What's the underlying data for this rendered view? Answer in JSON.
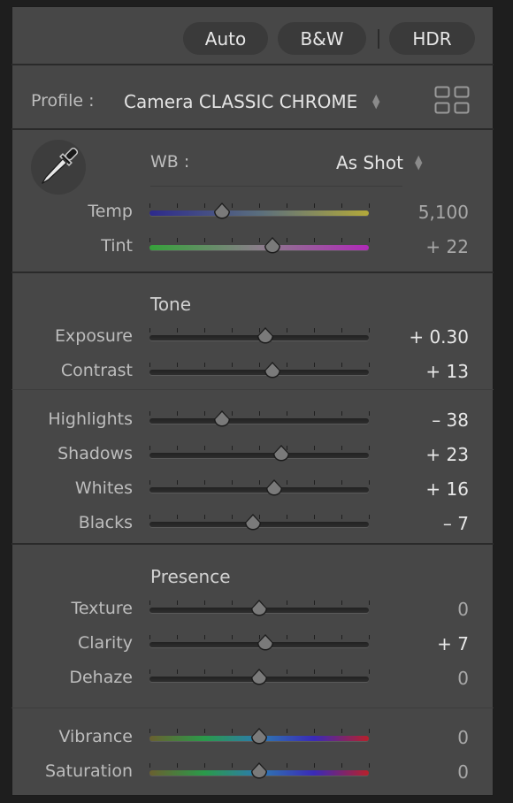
{
  "header": {
    "auto_label": "Auto",
    "bw_label": "B&W",
    "hdr_label": "HDR"
  },
  "profile": {
    "label": "Profile :",
    "value": "Camera CLASSIC CHROME",
    "browse_icon": "grid-icon"
  },
  "white_balance": {
    "picker_icon": "eyedropper-icon",
    "label": "WB :",
    "value": "As Shot"
  },
  "sections": {
    "tone": "Tone",
    "presence": "Presence"
  },
  "sliders": [
    {
      "key": "temp",
      "label": "Temp",
      "value": "5,100",
      "position": 0.33,
      "track": "temp",
      "dim": true
    },
    {
      "key": "tint",
      "label": "Tint",
      "value": "+ 22",
      "position": 0.56,
      "track": "tint",
      "dim": true
    },
    {
      "key": "exposure",
      "label": "Exposure",
      "value": "+ 0.30",
      "position": 0.53,
      "track": "neutral",
      "dim": false
    },
    {
      "key": "contrast",
      "label": "Contrast",
      "value": "+ 13",
      "position": 0.56,
      "track": "neutral",
      "dim": false
    },
    {
      "key": "highlights",
      "label": "Highlights",
      "value": "– 38",
      "position": 0.33,
      "track": "neutral",
      "dim": false
    },
    {
      "key": "shadows",
      "label": "Shadows",
      "value": "+ 23",
      "position": 0.6,
      "track": "neutral",
      "dim": false
    },
    {
      "key": "whites",
      "label": "Whites",
      "value": "+ 16",
      "position": 0.57,
      "track": "neutral",
      "dim": false
    },
    {
      "key": "blacks",
      "label": "Blacks",
      "value": "– 7",
      "position": 0.47,
      "track": "neutral",
      "dim": false
    },
    {
      "key": "texture",
      "label": "Texture",
      "value": "0",
      "position": 0.5,
      "track": "neutral",
      "dim": true
    },
    {
      "key": "clarity",
      "label": "Clarity",
      "value": "+ 7",
      "position": 0.53,
      "track": "neutral",
      "dim": false
    },
    {
      "key": "dehaze",
      "label": "Dehaze",
      "value": "0",
      "position": 0.5,
      "track": "neutral",
      "dim": true
    },
    {
      "key": "vibrance",
      "label": "Vibrance",
      "value": "0",
      "position": 0.5,
      "track": "rainbow",
      "dim": true
    },
    {
      "key": "saturation",
      "label": "Saturation",
      "value": "0",
      "position": 0.5,
      "track": "rainbow",
      "dim": true
    }
  ],
  "colors": {
    "panel": "#474747",
    "temp_track": [
      "#2d2a8c",
      "#5a6e7e",
      "#b3a93a"
    ],
    "tint_track": [
      "#35a23a",
      "#8a7e8a",
      "#b02ab8"
    ],
    "rainbow_track": [
      "#6a6030",
      "#2a9a4a",
      "#2d7ab0",
      "#3a2ab8",
      "#b8202a"
    ]
  }
}
